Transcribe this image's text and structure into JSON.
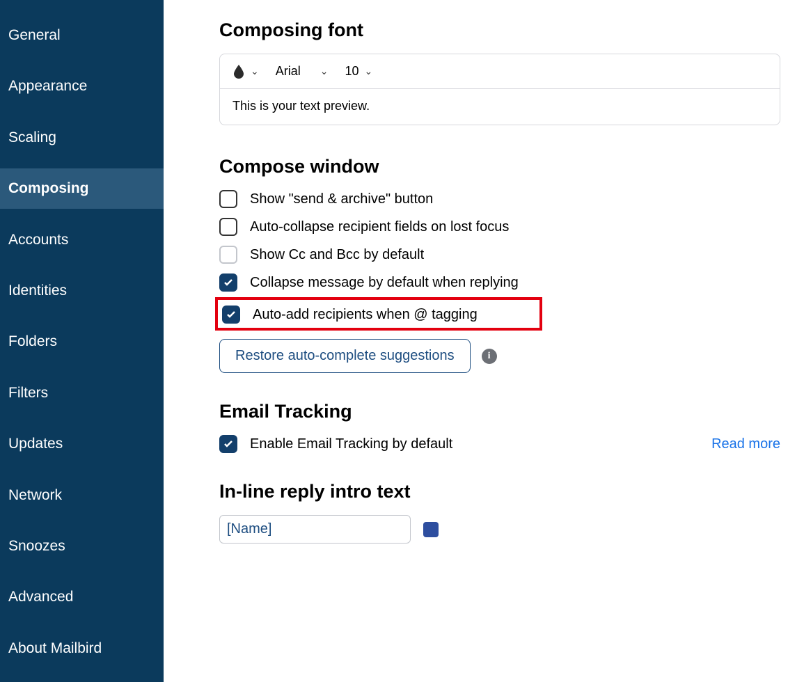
{
  "sidebar": {
    "items": [
      {
        "label": "General"
      },
      {
        "label": "Appearance"
      },
      {
        "label": "Scaling"
      },
      {
        "label": "Composing",
        "active": true
      },
      {
        "label": "Accounts"
      },
      {
        "label": "Identities"
      },
      {
        "label": "Folders"
      },
      {
        "label": "Filters"
      },
      {
        "label": "Updates"
      },
      {
        "label": "Network"
      },
      {
        "label": "Snoozes"
      },
      {
        "label": "Advanced"
      },
      {
        "label": "About Mailbird"
      }
    ]
  },
  "composing_font": {
    "title": "Composing font",
    "color_value": "#000000",
    "font_family": "Arial",
    "font_size": "10",
    "preview": "This is your text preview."
  },
  "compose_window": {
    "title": "Compose window",
    "options": [
      {
        "label": "Show \"send & archive\" button",
        "checked": false,
        "light": false
      },
      {
        "label": "Auto-collapse recipient fields on lost focus",
        "checked": false,
        "light": false
      },
      {
        "label": "Show Cc and Bcc by default",
        "checked": false,
        "light": true
      },
      {
        "label": "Collapse message by default when replying",
        "checked": true,
        "light": false
      },
      {
        "label": "Auto-add recipients when @ tagging",
        "checked": true,
        "light": false,
        "highlight": true
      }
    ],
    "restore_button": "Restore auto-complete suggestions"
  },
  "email_tracking": {
    "title": "Email Tracking",
    "option_label": "Enable Email Tracking by default",
    "checked": true,
    "read_more": "Read more"
  },
  "inline_reply": {
    "title": "In-line reply intro text",
    "value": "[Name]",
    "color": "#2e4e9f"
  }
}
